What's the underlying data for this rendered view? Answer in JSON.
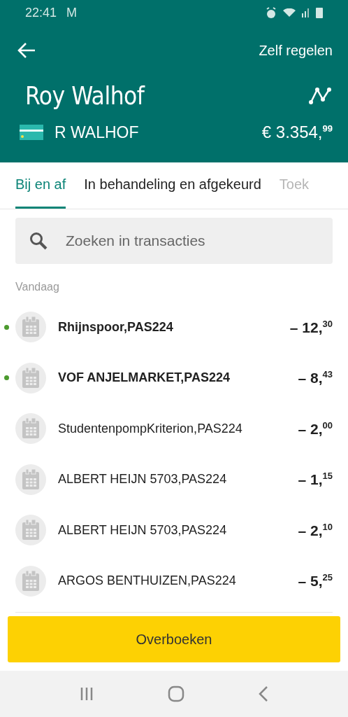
{
  "status_bar": {
    "time": "22:41",
    "notification": "M"
  },
  "header": {
    "action": "Zelf regelen",
    "name": "Roy Walhof",
    "account_holder": "R WALHOF",
    "balance": "€ 3.354,",
    "balance_cents": "99"
  },
  "tabs": [
    {
      "label": "Bij en af",
      "selected": true
    },
    {
      "label": "In behandeling en afgekeurd",
      "selected": false
    },
    {
      "label": "Toek",
      "selected": false
    }
  ],
  "search": {
    "placeholder": "Zoeken in transacties"
  },
  "section": "Vandaag",
  "transactions": [
    {
      "name": "Rhijnspoor,PAS224",
      "amount": "– 12,",
      "cents": "30",
      "unread": true
    },
    {
      "name": "VOF ANJELMARKET,PAS224",
      "amount": "– 8,",
      "cents": "43",
      "unread": true
    },
    {
      "name": "StudentenpompKriterion,PAS224",
      "amount": "– 2,",
      "cents": "00",
      "unread": false
    },
    {
      "name": "ALBERT HEIJN 5703,PAS224",
      "amount": "– 1,",
      "cents": "15",
      "unread": false
    },
    {
      "name": "ALBERT HEIJN 5703,PAS224",
      "amount": "– 2,",
      "cents": "10",
      "unread": false
    },
    {
      "name": "ARGOS BENTHUIZEN,PAS224",
      "amount": "– 5,",
      "cents": "25",
      "unread": false
    }
  ],
  "primary_button": "Overboeken"
}
